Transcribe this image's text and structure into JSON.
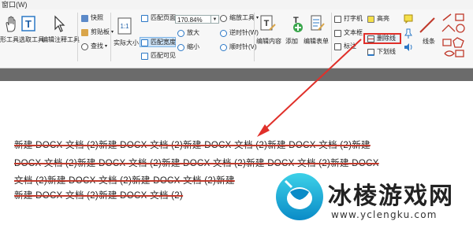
{
  "menubar": {
    "window_menu": "窗口(W)"
  },
  "ribbon": {
    "left_cut_label": "形工具",
    "hand_tool": "选取工具",
    "select_text": "选取工具",
    "edit_annot_tool": "编辑注释工具",
    "snapshot": "快照",
    "clipboard": "剪贴板",
    "find": "查找",
    "actual_size": "实际大小",
    "fit_page": "匹配页面",
    "fit_width": "匹配宽度",
    "fit_visible": "匹配可见",
    "zoom_value": "170.84%",
    "zoom_in": "放大",
    "zoom_out": "缩小",
    "zoom_tool": "缩放工具",
    "rotate_ccw": "逆时针(W)",
    "rotate_cw": "顺时针(V)",
    "edit_content": "编辑内容",
    "add": "添加",
    "edit_form": "编辑表单",
    "typewriter": "打字机",
    "textbox": "文本框",
    "callout": "标注",
    "highlight": "高亮",
    "strikeout": "删除线",
    "underline": "下划线",
    "line": "线条"
  },
  "document": {
    "lines": [
      "新建 DOCX 文档 (2)新建 DOCX 文档 (2)新建 DOCX 文档 (2)新建 DOCX 文档 (2)新建",
      "DOCX 文档 (2)新建 DOCX 文档 (2)新建 DOCX 文档 (2)新建 DOCX 文档 (2)新建 DOCX",
      "文档 (2)新建 DOCX 文档 (2)新建 DOCX 文档 (2)新建",
      "新建 DOCX 文档 (2)新建 DOCX 文档 (2)"
    ]
  },
  "watermark": {
    "title": "冰棱游戏网",
    "url": "www.yclengku.com"
  },
  "colors": {
    "strike": "#c0392b",
    "arrow": "#e0302a",
    "accent": "#2b78c6"
  }
}
